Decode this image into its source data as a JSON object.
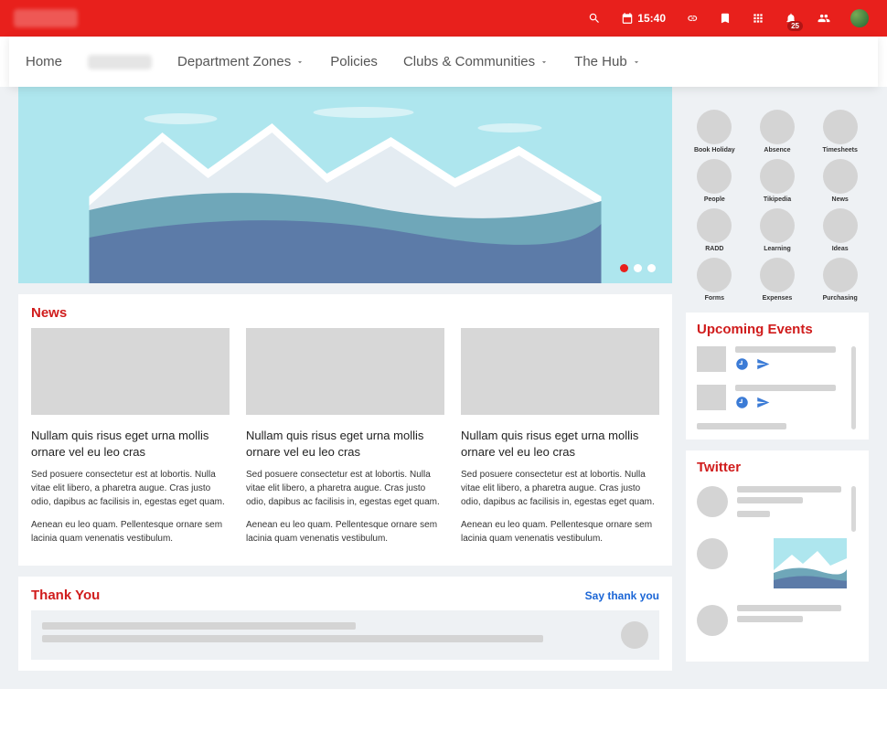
{
  "topbar": {
    "time": "15:40",
    "notification_count": "25"
  },
  "nav": {
    "home": "Home",
    "dept": "Department Zones",
    "policies": "Policies",
    "clubs": "Clubs & Communities",
    "hub": "The Hub"
  },
  "shortcuts": [
    "Book Holiday",
    "Absence",
    "Timesheets",
    "People",
    "Tikipedia",
    "News",
    "RADD",
    "Learning",
    "Ideas",
    "Forms",
    "Expenses",
    "Purchasing"
  ],
  "sections": {
    "news": "News",
    "thanks": "Thank You",
    "say_thanks": "Say thank you",
    "events": "Upcoming Events",
    "twitter": "Twitter"
  },
  "news_items": [
    {
      "headline": "Nullam quis risus eget urna mollis ornare vel eu leo cras",
      "p1": "Sed posuere consectetur est at lobortis. Nulla vitae elit libero, a pharetra augue. Cras justo odio, dapibus ac facilisis in, egestas eget quam.",
      "p2": "Aenean eu leo quam. Pellentesque ornare sem lacinia quam venenatis vestibulum."
    },
    {
      "headline": "Nullam quis risus eget urna mollis ornare vel eu leo cras",
      "p1": "Sed posuere consectetur est at lobortis. Nulla vitae elit libero, a pharetra augue. Cras justo odio, dapibus ac facilisis in, egestas eget quam.",
      "p2": "Aenean eu leo quam. Pellentesque ornare sem lacinia quam venenatis vestibulum."
    },
    {
      "headline": "Nullam quis risus eget urna mollis ornare vel eu leo cras",
      "p1": "Sed posuere consectetur est at lobortis. Nulla vitae elit libero, a pharetra augue. Cras justo odio, dapibus ac facilisis in, egestas eget quam.",
      "p2": "Aenean eu leo quam. Pellentesque ornare sem lacinia quam venenatis vestibulum."
    }
  ]
}
